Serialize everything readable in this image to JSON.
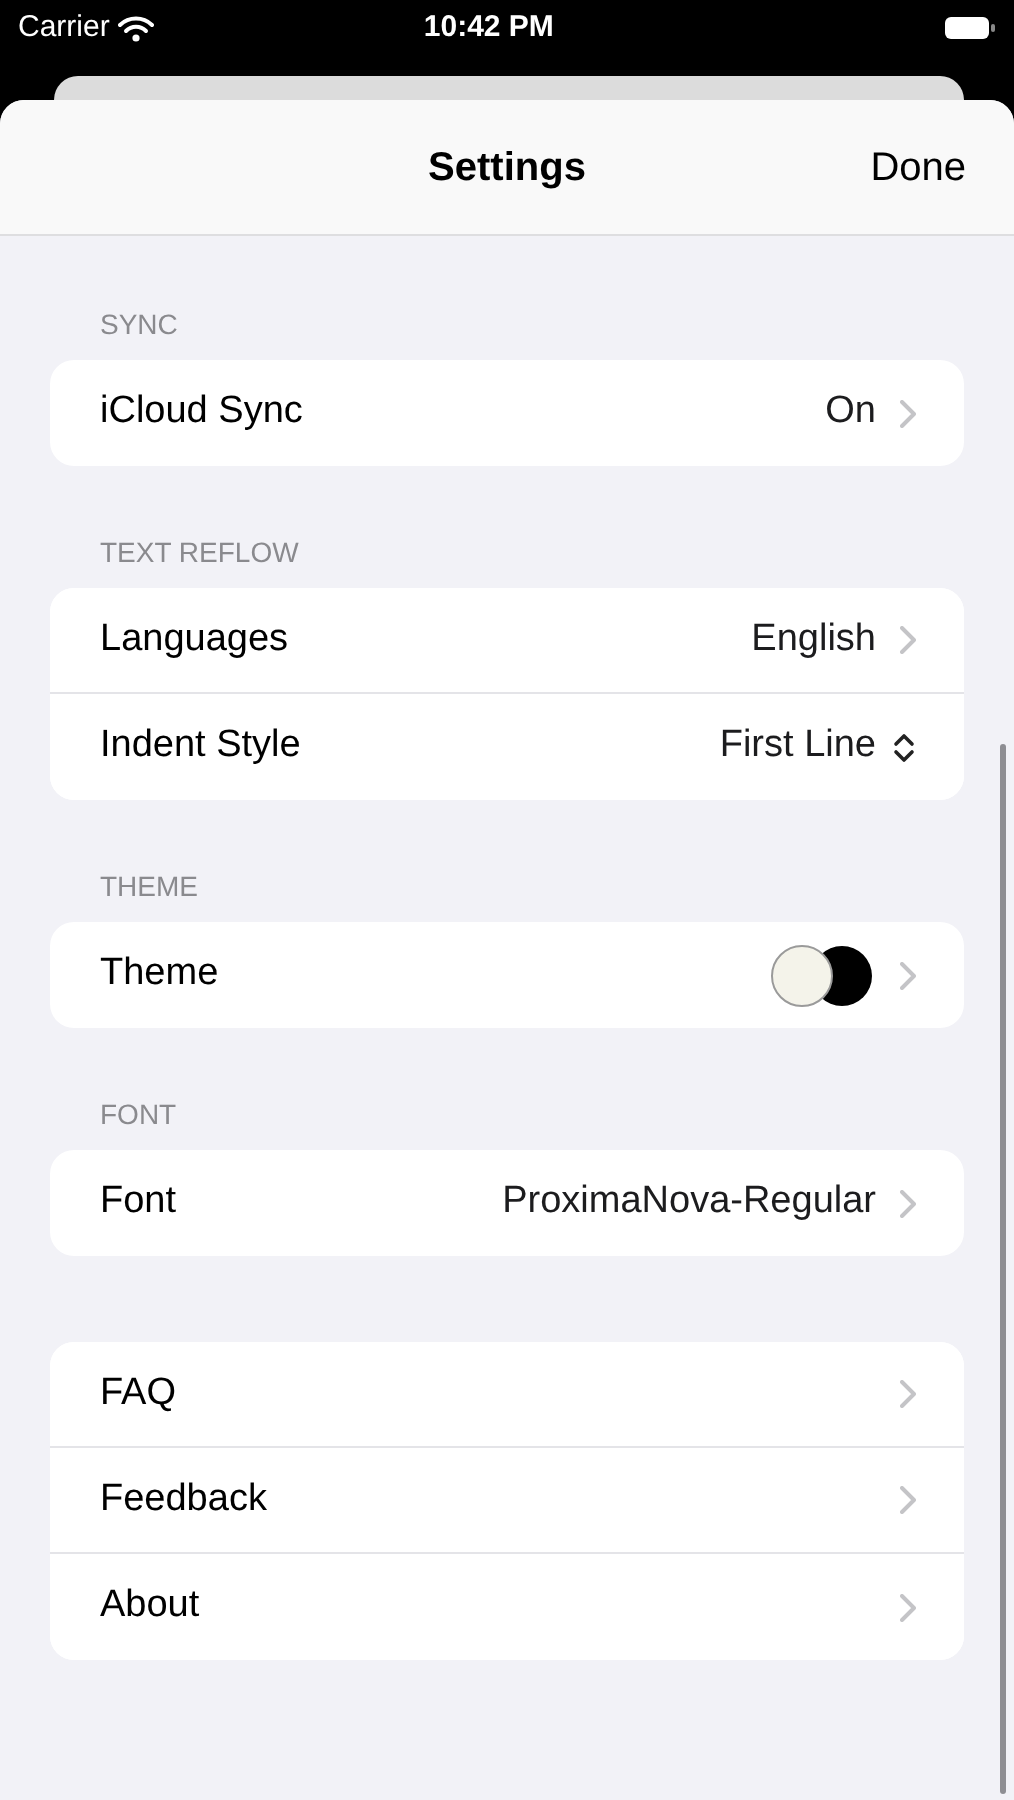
{
  "status_bar": {
    "carrier": "Carrier",
    "time": "10:42 PM"
  },
  "nav": {
    "title": "Settings",
    "done": "Done"
  },
  "sections": [
    {
      "header": "SYNC",
      "rows": [
        {
          "kind": "value",
          "label": "iCloud Sync",
          "value": "On"
        }
      ]
    },
    {
      "header": "TEXT REFLOW",
      "rows": [
        {
          "kind": "value",
          "label": "Languages",
          "value": "English"
        },
        {
          "kind": "picker",
          "label": "Indent Style",
          "value": "First Line"
        }
      ]
    },
    {
      "header": "THEME",
      "rows": [
        {
          "kind": "theme",
          "label": "Theme"
        }
      ]
    },
    {
      "header": "FONT",
      "rows": [
        {
          "kind": "value",
          "label": "Font",
          "value": "ProximaNova-Regular"
        }
      ]
    },
    {
      "rows": [
        {
          "kind": "link",
          "label": "FAQ"
        },
        {
          "kind": "link",
          "label": "Feedback"
        },
        {
          "kind": "link",
          "label": "About"
        }
      ]
    }
  ]
}
